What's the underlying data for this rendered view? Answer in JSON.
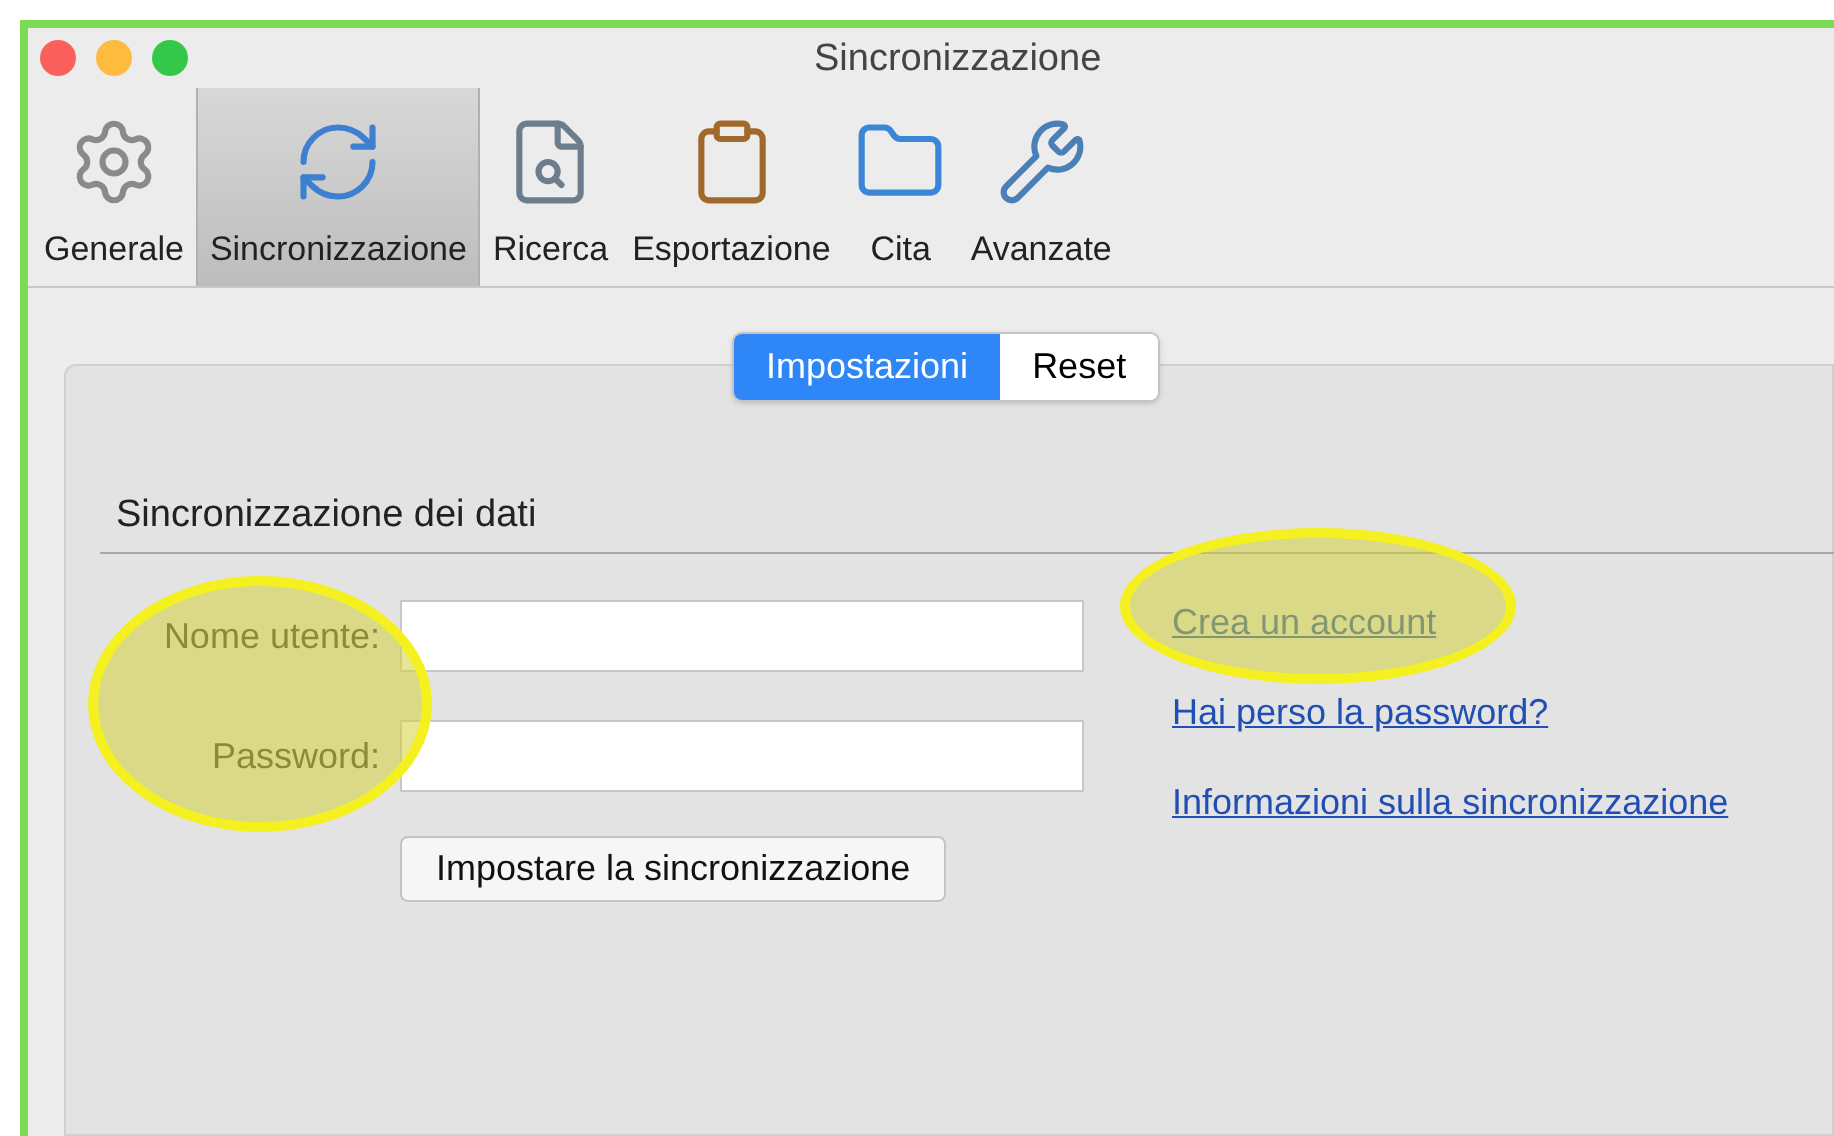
{
  "window": {
    "title": "Sincronizzazione"
  },
  "toolbar": {
    "items": [
      {
        "kind": "gear",
        "label": "Generale",
        "selected": false
      },
      {
        "kind": "sync",
        "label": "Sincronizzazione",
        "selected": true
      },
      {
        "kind": "search",
        "label": "Ricerca",
        "selected": false
      },
      {
        "kind": "clipboard",
        "label": "Esportazione",
        "selected": false
      },
      {
        "kind": "folder",
        "label": "Cita",
        "selected": false
      },
      {
        "kind": "tools",
        "label": "Avanzate",
        "selected": false
      }
    ]
  },
  "segments": [
    {
      "label": "Impostazioni",
      "selected": true
    },
    {
      "label": "Reset",
      "selected": false
    }
  ],
  "section": {
    "title": "Sincronizzazione dei dati"
  },
  "fields": [
    {
      "label": "Nome utente:"
    },
    {
      "label": "Password:"
    }
  ],
  "button": "Impostare la sincronizzazione",
  "links": [
    "Crea un account",
    "Hai perso la password?",
    "Informazioni sulla sincronizzazione"
  ]
}
